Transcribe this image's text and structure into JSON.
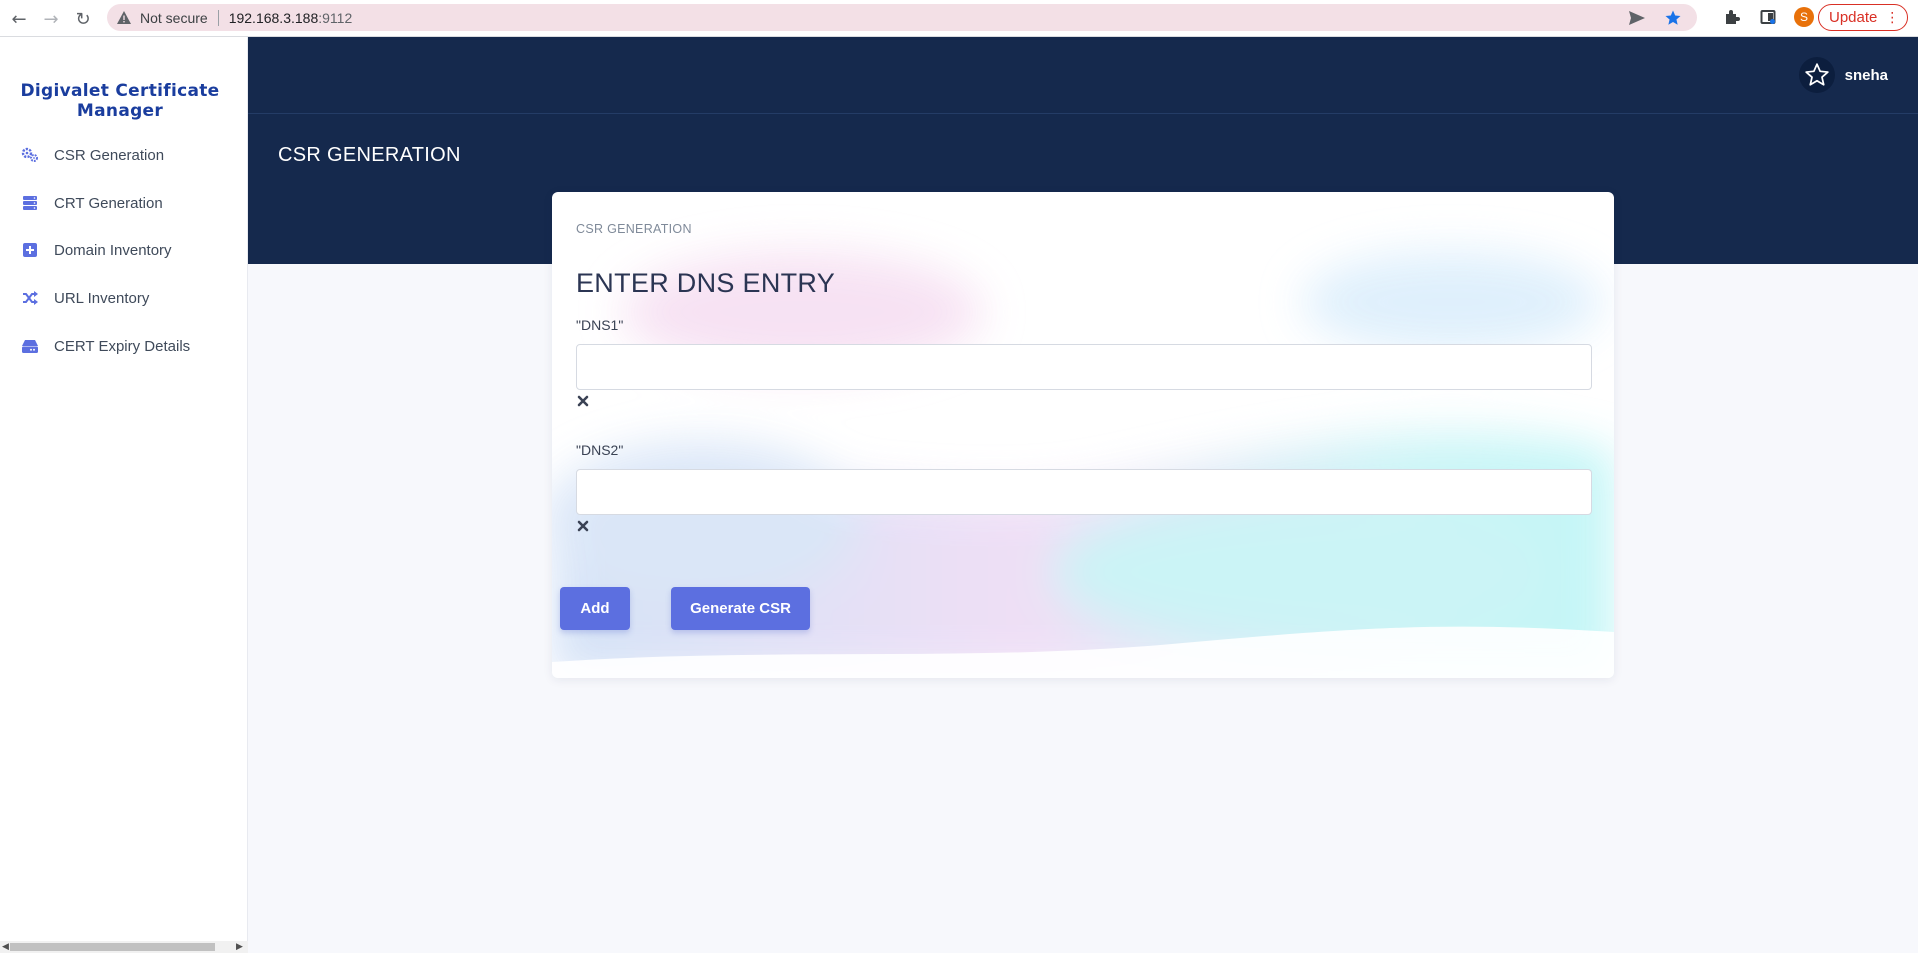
{
  "browser": {
    "security_label": "Not secure",
    "url_host": "192.168.3.188",
    "url_port": ":9112",
    "profile_initial": "S",
    "update_label": "Update"
  },
  "sidebar": {
    "brand_line1": "Digivalet Certificate",
    "brand_line2": "Manager",
    "items": [
      {
        "label": "CSR Generation",
        "icon": "cogs-icon"
      },
      {
        "label": "CRT Generation",
        "icon": "server-icon"
      },
      {
        "label": "Domain Inventory",
        "icon": "plus-square-icon"
      },
      {
        "label": "URL Inventory",
        "icon": "shuffle-icon"
      },
      {
        "label": "CERT Expiry Details",
        "icon": "hdd-icon"
      }
    ]
  },
  "header": {
    "user_name": "sneha",
    "page_title": "CSR GENERATION"
  },
  "card": {
    "subtitle": "CSR GENERATION",
    "title": "ENTER DNS ENTRY",
    "fields": [
      {
        "label": "\"DNS1\"",
        "value": ""
      },
      {
        "label": "\"DNS2\"",
        "value": ""
      }
    ],
    "add_label": "Add",
    "generate_label": "Generate CSR"
  },
  "colors": {
    "accent": "#5c6fe0",
    "header_bg": "#15294d",
    "brand": "#1a3d9e"
  }
}
